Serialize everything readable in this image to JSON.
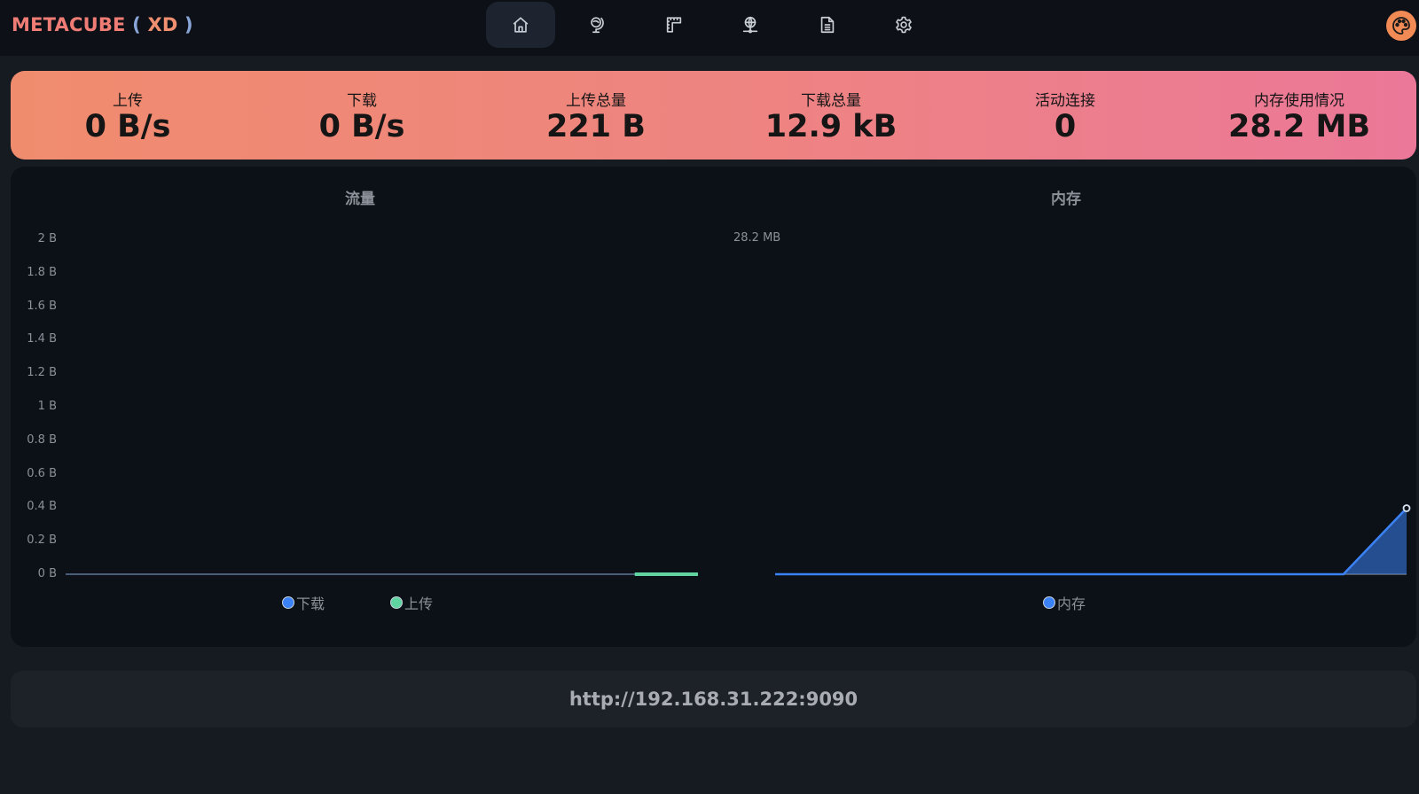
{
  "app": {
    "logo_part1": "METACUBE",
    "logo_part2": " ( ",
    "logo_part3": "XD",
    "logo_part4": " )"
  },
  "nav": [
    {
      "icon": "home-icon",
      "active": true
    },
    {
      "icon": "globe-stand-icon",
      "active": false
    },
    {
      "icon": "ruler-icon",
      "active": false
    },
    {
      "icon": "network-icon",
      "active": false
    },
    {
      "icon": "document-icon",
      "active": false
    },
    {
      "icon": "gear-icon",
      "active": false
    }
  ],
  "theme_button": {
    "icon": "palette-icon"
  },
  "stats": [
    {
      "label": "上传",
      "value": "0 B/s"
    },
    {
      "label": "下载",
      "value": "0 B/s"
    },
    {
      "label": "上传总量",
      "value": "221 B"
    },
    {
      "label": "下载总量",
      "value": "12.9 kB"
    },
    {
      "label": "活动连接",
      "value": "0"
    },
    {
      "label": "内存使用情况",
      "value": "28.2 MB"
    }
  ],
  "chart_data": [
    {
      "type": "line",
      "title": "流量",
      "yticks": [
        "0 B",
        "0.2 B",
        "0.4 B",
        "0.6 B",
        "0.8 B",
        "1 B",
        "1.2 B",
        "1.4 B",
        "1.6 B",
        "1.8 B",
        "2 B"
      ],
      "ylim": [
        0,
        2
      ],
      "series": [
        {
          "name": "下载",
          "color": "#3b82f6",
          "values": [
            0,
            0,
            0,
            0,
            0,
            0,
            0,
            0,
            0,
            0,
            0
          ]
        },
        {
          "name": "上传",
          "color": "#5fd3a0",
          "values": [
            0,
            0,
            0,
            0,
            0,
            0,
            0,
            0,
            0,
            0,
            0
          ]
        }
      ]
    },
    {
      "type": "area",
      "title": "内存",
      "annotation": "28.2 MB",
      "series": [
        {
          "name": "内存",
          "color": "#3b82f6",
          "values": [
            0,
            0,
            0,
            0,
            0,
            0,
            0,
            0,
            0,
            0,
            28.2
          ]
        }
      ]
    }
  ],
  "footer": {
    "url": "http://192.168.31.222:9090"
  }
}
